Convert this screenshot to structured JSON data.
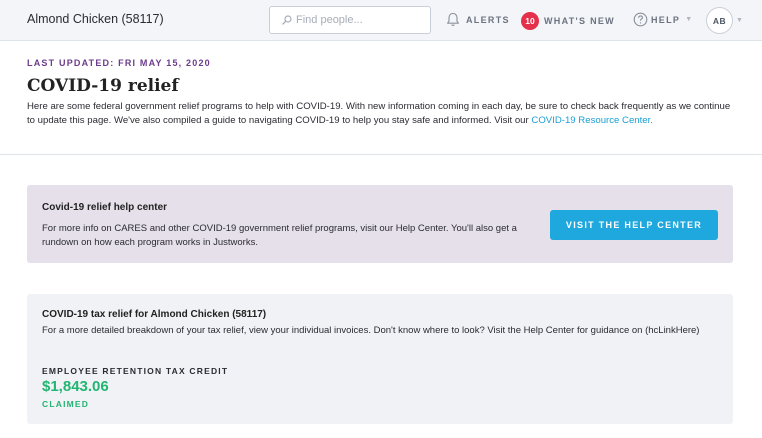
{
  "topbar": {
    "company": "Almond Chicken (58117)",
    "search_placeholder": "Find people...",
    "alerts_label": "ALERTS",
    "whats_new_badge": "10",
    "whats_new_label": "WHAT'S NEW",
    "help_label": "HELP",
    "avatar_initials": "AB",
    "icons": [
      "search-icon",
      "bell-icon",
      "question-icon",
      "chevron-down-icon"
    ]
  },
  "header": {
    "last_updated": "LAST UPDATED: FRI MAY 15, 2020",
    "title": "COVID-19 relief",
    "intro_text": "Here are some federal government relief programs to help with COVID-19. With new information coming in each day, be sure to check back frequently as we continue to update this page. We've also compiled a guide to navigating COVID-19 to help you stay safe and informed. Visit our ",
    "intro_link": "COVID-19 Resource Center."
  },
  "help_card": {
    "title": "Covid-19 relief help center",
    "body": "For more info on CARES and other COVID-19 government relief programs, visit our Help Center. You'll also get a rundown on how each program works in Justworks.",
    "button_label": "VISIT THE HELP CENTER"
  },
  "tax_card": {
    "title": "COVID-19 tax relief for Almond Chicken (58117)",
    "body": "For a more detailed breakdown of your tax relief, view your individual invoices. Don't know where to look? Visit the Help Center for guidance on (hcLinkHere)",
    "credit_label": "EMPLOYEE RETENTION TAX CREDIT",
    "credit_amount": "$1,843.06",
    "credit_status": "CLAIMED"
  },
  "colors": {
    "accent_blue": "#1fa8dd",
    "purple_label": "#6b3b8c",
    "badge_red": "#e5304b",
    "success_green": "#22b573",
    "help_card_bg": "#e6e0ea",
    "tax_card_bg": "#f0f2f5"
  }
}
